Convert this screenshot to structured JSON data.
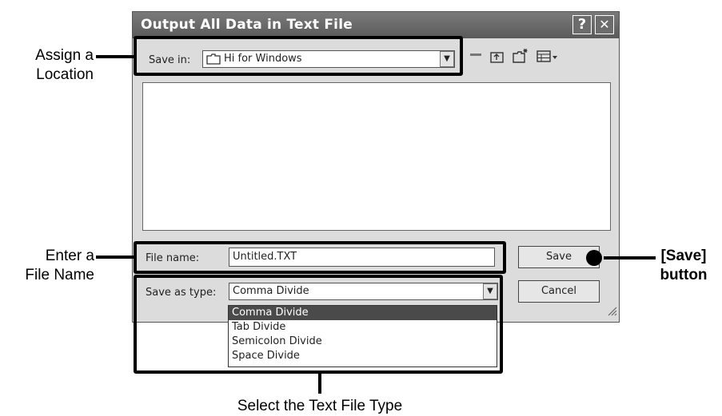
{
  "dialog": {
    "title": "Output All Data in Text File",
    "help_label": "?",
    "close_label": "✕"
  },
  "save_in": {
    "label": "Save in:",
    "value": "Hi for Windows"
  },
  "toolbar_icons": [
    "back-icon",
    "up-folder-icon",
    "new-folder-icon",
    "view-menu-icon"
  ],
  "file_name": {
    "label": "File name:",
    "value": "Untitled.TXT"
  },
  "save_as_type": {
    "label": "Save as type:",
    "value": "Comma Divide",
    "options": [
      "Comma Divide",
      "Tab Divide",
      "Semicolon Divide",
      "Space Divide"
    ]
  },
  "buttons": {
    "save": "Save",
    "cancel": "Cancel"
  },
  "annotations": {
    "assign_location": [
      "Assign a",
      "Location"
    ],
    "enter_file_name": [
      "Enter a",
      "File Name"
    ],
    "save_button": [
      "[Save]",
      "button"
    ],
    "select_type": "Select the Text File Type"
  }
}
